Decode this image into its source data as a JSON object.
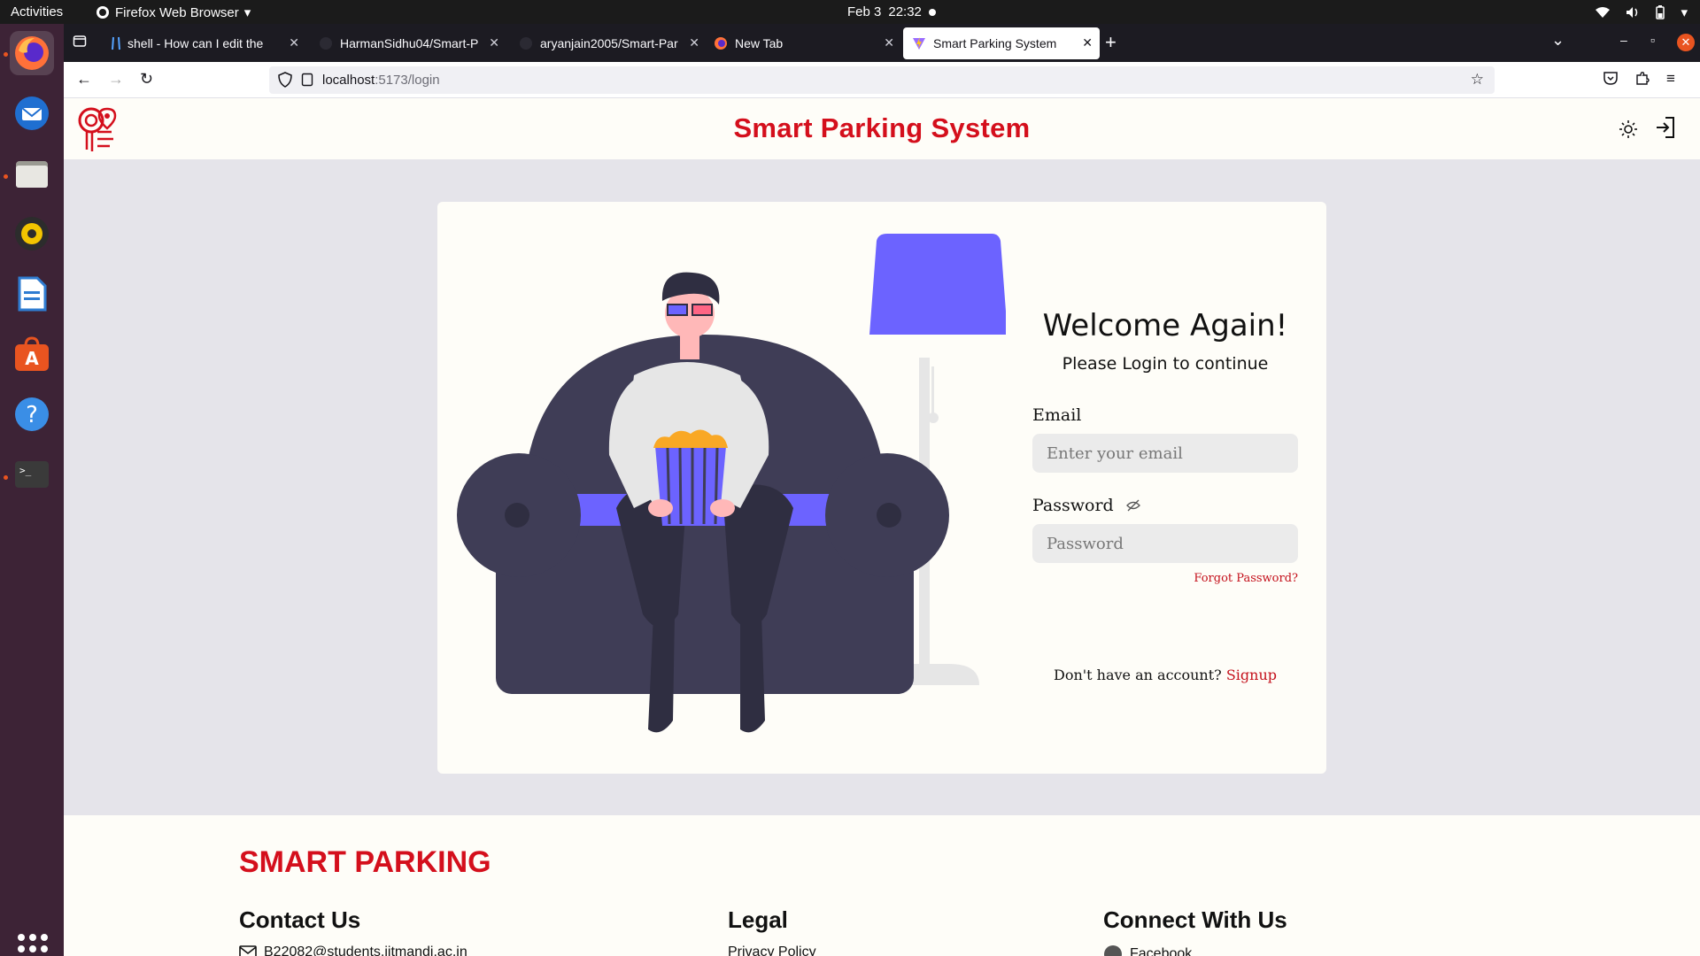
{
  "system": {
    "activities": "Activities",
    "app_name": "Firefox Web Browser",
    "date": "Feb 3",
    "time": "22:32"
  },
  "browser": {
    "tabs": [
      {
        "title": "shell - How can I edit the"
      },
      {
        "title": "HarmanSidhu04/Smart-P"
      },
      {
        "title": "aryanjain2005/Smart-Par"
      },
      {
        "title": "New Tab"
      },
      {
        "title": "Smart Parking System"
      }
    ],
    "url_host": "localhost",
    "url_path": ":5173/login"
  },
  "site": {
    "title": "Smart Parking System"
  },
  "login": {
    "welcome": "Welcome Again!",
    "subtitle": "Please Login to continue",
    "email_label": "Email",
    "email_placeholder": "Enter your email",
    "password_label": "Password",
    "password_placeholder": "Password",
    "forgot": "Forgot Password?",
    "no_account": "Don't have an account?",
    "signup": "Signup"
  },
  "footer": {
    "brand": "SMART PARKING",
    "contact_title": "Contact Us",
    "contact_email": "B22082@students.iitmandi.ac.in",
    "legal_title": "Legal",
    "legal_item": "Privacy Policy",
    "connect_title": "Connect With Us",
    "connect_item": "Facebook"
  },
  "colors": {
    "brand_red": "#d40f1c",
    "accent_purple": "#6c63ff",
    "sofa_dark": "#3f3d56"
  }
}
